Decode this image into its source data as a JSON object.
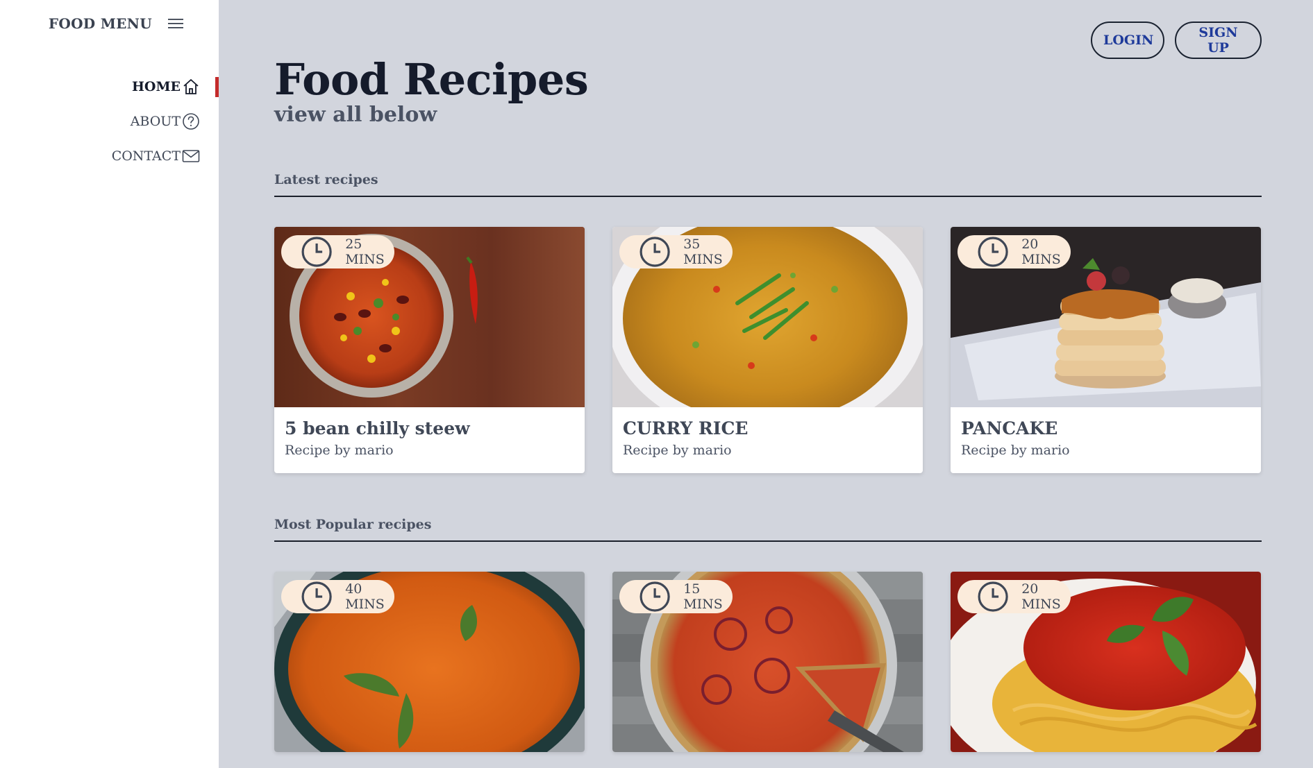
{
  "sidebar": {
    "brand": "FOOD MENU",
    "menu_icon": "hamburger-icon",
    "items": [
      {
        "label": "HOME",
        "icon": "home-icon",
        "active": true
      },
      {
        "label": "ABOUT",
        "icon": "question-circle-icon",
        "active": false
      },
      {
        "label": "CONTACT",
        "icon": "envelope-icon",
        "active": false
      }
    ]
  },
  "header": {
    "login_label": "LOGIN",
    "signup_label": "SIGN UP"
  },
  "page": {
    "title": "Food Recipes",
    "subtitle": "view all below"
  },
  "latest": {
    "heading": "Latest recipes",
    "cards": [
      {
        "time": "25 MINS",
        "title": "5 bean chilly steew",
        "author": "Recipe by mario"
      },
      {
        "time": "35 MINS",
        "title": "CURRY RICE",
        "author": "Recipe by mario"
      },
      {
        "time": "20 MINS",
        "title": "PANCAKE",
        "author": "Recipe by mario"
      }
    ]
  },
  "popular": {
    "heading": "Most Popular recipes",
    "cards": [
      {
        "time": "40 MINS"
      },
      {
        "time": "15 MINS"
      },
      {
        "time": "20 MINS"
      }
    ]
  },
  "colors": {
    "accent": "#c42b2b",
    "link_blue": "#1e3a9a",
    "main_bg": "#d2d5dd",
    "badge_bg": "#fbebdb"
  }
}
